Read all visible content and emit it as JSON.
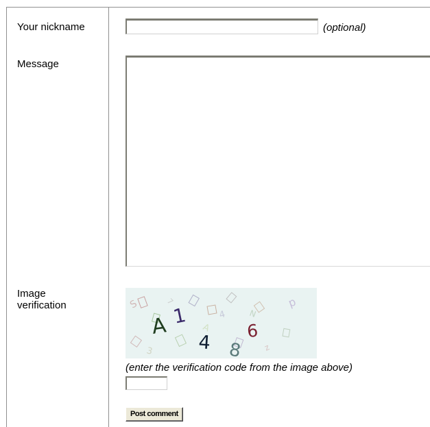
{
  "form": {
    "nickname_label": "Your nickname",
    "nickname_value": "",
    "nickname_hint": "(optional)",
    "message_label": "Message",
    "message_value": "",
    "image_label": "Image verification",
    "captcha_text": "A1486",
    "verification_hint": "(enter the verification code from the image above)",
    "verification_value": "",
    "submit_label": "Post comment"
  },
  "colors": {
    "border": "#909090",
    "captcha_bg": "#e9f3f2",
    "button_bg": "#ece9d8"
  }
}
